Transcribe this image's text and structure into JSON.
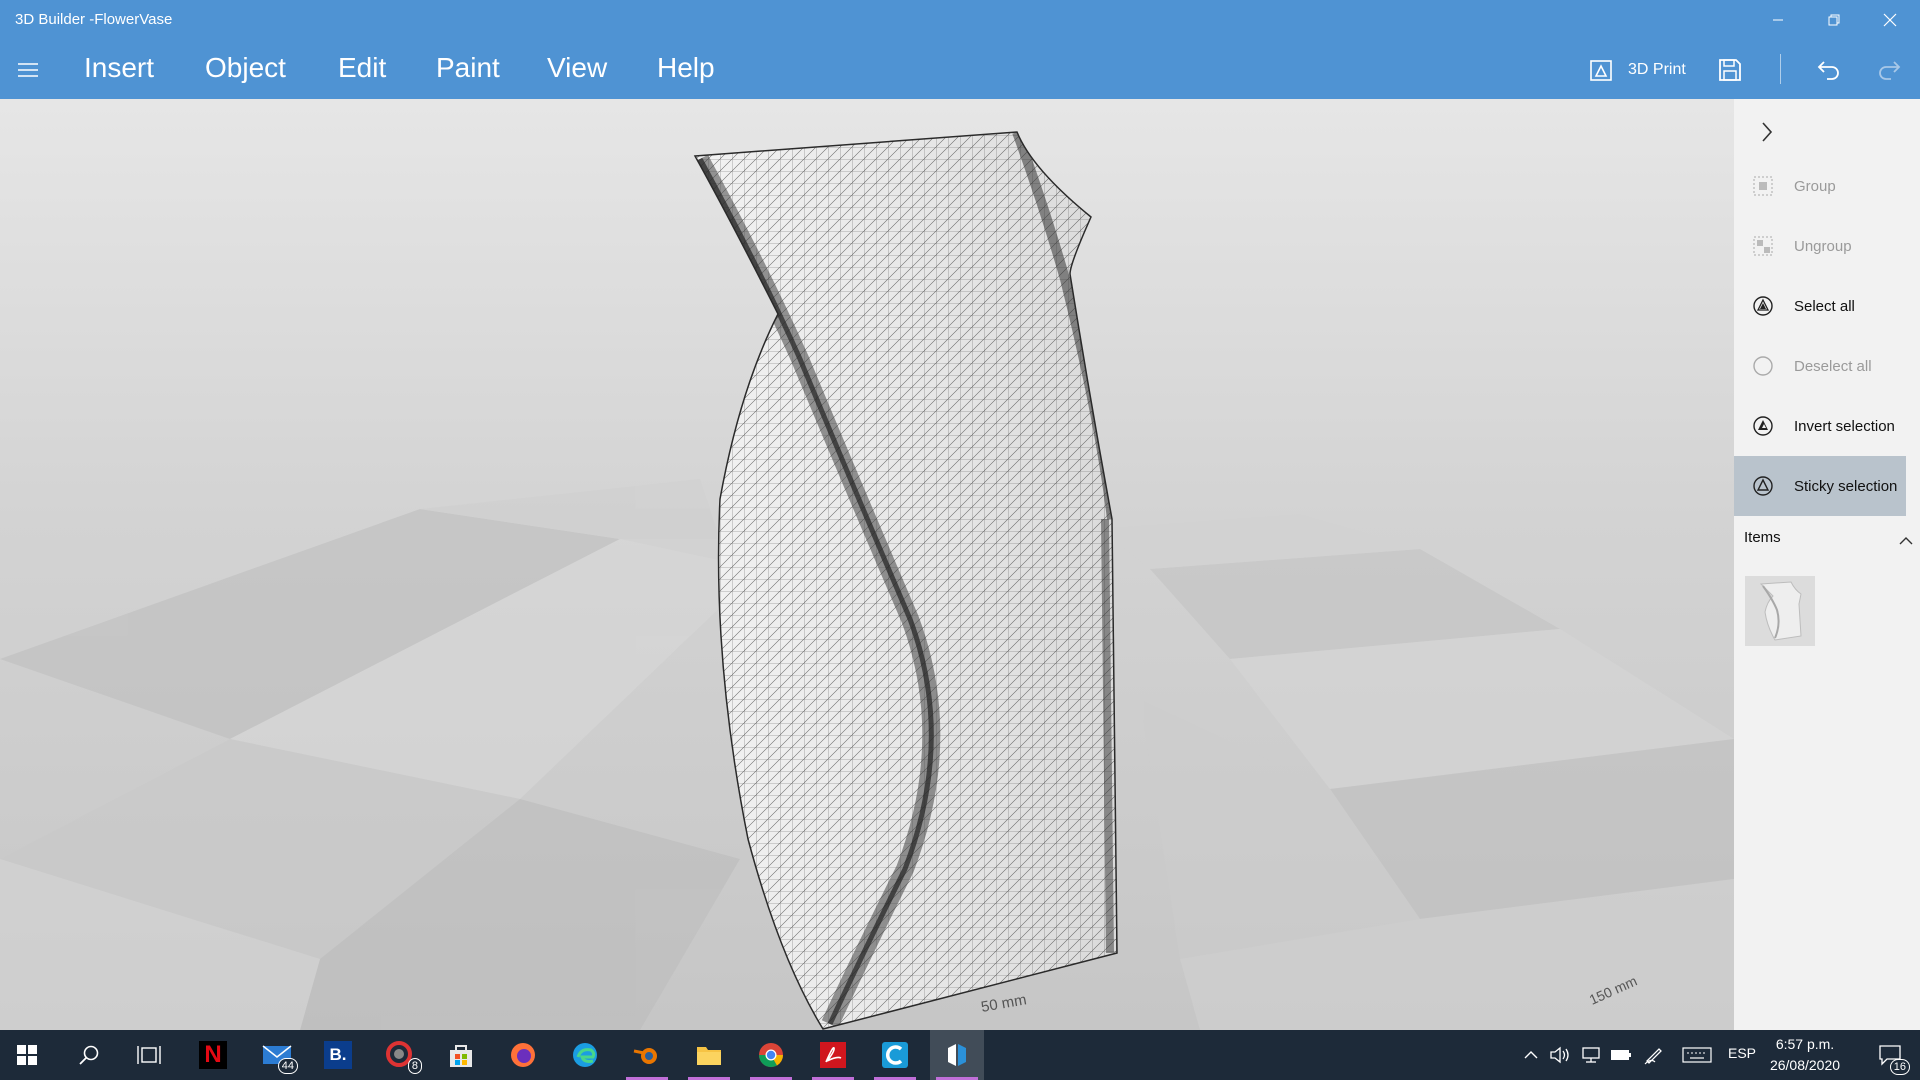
{
  "window": {
    "title": "3D Builder -FlowerVase"
  },
  "menu": [
    {
      "label": "Insert"
    },
    {
      "label": "Object"
    },
    {
      "label": "Edit"
    },
    {
      "label": "Paint"
    },
    {
      "label": "View"
    },
    {
      "label": "Help"
    }
  ],
  "toolbar": {
    "print_label": "3D Print"
  },
  "viewport": {
    "scale_labels": [
      "50 mm",
      "150 mm"
    ]
  },
  "panel": {
    "items": [
      {
        "label": "Group",
        "icon": "group-icon",
        "state": "disabled"
      },
      {
        "label": "Ungroup",
        "icon": "ungroup-icon",
        "state": "disabled"
      },
      {
        "label": "Select all",
        "icon": "select-all-icon",
        "state": "enabled"
      },
      {
        "label": "Deselect all",
        "icon": "deselect-all-icon",
        "state": "disabled"
      },
      {
        "label": "Invert selection",
        "icon": "invert-selection-icon",
        "state": "enabled"
      },
      {
        "label": "Sticky selection",
        "icon": "sticky-selection-icon",
        "state": "active"
      }
    ],
    "items_header": "Items"
  },
  "taskbar": {
    "apps": [
      {
        "icon": "start-icon"
      },
      {
        "icon": "search-icon"
      },
      {
        "icon": "task-view-icon"
      },
      {
        "icon": "netflix-icon",
        "letter": "N"
      },
      {
        "icon": "mail-icon",
        "badge": "44"
      },
      {
        "icon": "booking-icon",
        "letter": "B."
      },
      {
        "icon": "app-icon",
        "badge": "8"
      },
      {
        "icon": "store-icon"
      },
      {
        "icon": "firefox-icon"
      },
      {
        "icon": "edge-icon"
      },
      {
        "icon": "blender-icon"
      },
      {
        "icon": "file-explorer-icon"
      },
      {
        "icon": "chrome-icon"
      },
      {
        "icon": "acrobat-icon"
      },
      {
        "icon": "ccleaner-icon"
      },
      {
        "icon": "3d-builder-icon"
      }
    ],
    "language": "ESP",
    "time": "6:57 p.m.",
    "date": "26/08/2020",
    "notification_count": "16"
  },
  "colors": {
    "header": "#4f93d3",
    "panel": "#f2f2f2",
    "taskbar": "#1d2a39",
    "running_indicator": "#c06fd8",
    "active_panel_item": "#b9c3cc"
  }
}
